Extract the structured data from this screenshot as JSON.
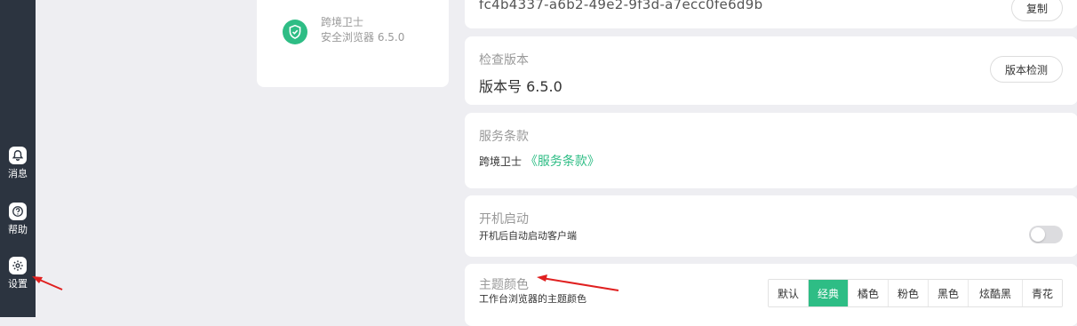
{
  "sidebar": {
    "items": [
      {
        "label": "消息",
        "icon": "bell-icon"
      },
      {
        "label": "帮助",
        "icon": "help-icon"
      },
      {
        "label": "设置",
        "icon": "gear-icon"
      }
    ]
  },
  "app_card": {
    "name": "跨境卫士",
    "version_line": "安全浏览器 6.5.0",
    "logo_icon": "shield-icon"
  },
  "device_id": {
    "value": "fc4b4337-a6b2-49e2-9f3d-a7ecc0fe6d9b",
    "copy_label": "复制"
  },
  "check_version": {
    "title": "检查版本",
    "version_text": "版本号 6.5.0",
    "button_label": "版本检测"
  },
  "terms": {
    "title": "服务条款",
    "prefix": "跨境卫士",
    "link_text": "《服务条款》"
  },
  "boot": {
    "title": "开机启动",
    "subtitle": "开机后自动启动客户端",
    "enabled": false
  },
  "theme": {
    "title": "主题颜色",
    "subtitle": "工作台浏览器的主题颜色",
    "options": [
      "默认",
      "经典",
      "橘色",
      "粉色",
      "黑色",
      "炫酷黑",
      "青花"
    ],
    "selected": "经典"
  },
  "colors": {
    "accent": "#2ebd85",
    "sidebar": "#2c3440",
    "annotation_arrow": "#e02020"
  }
}
